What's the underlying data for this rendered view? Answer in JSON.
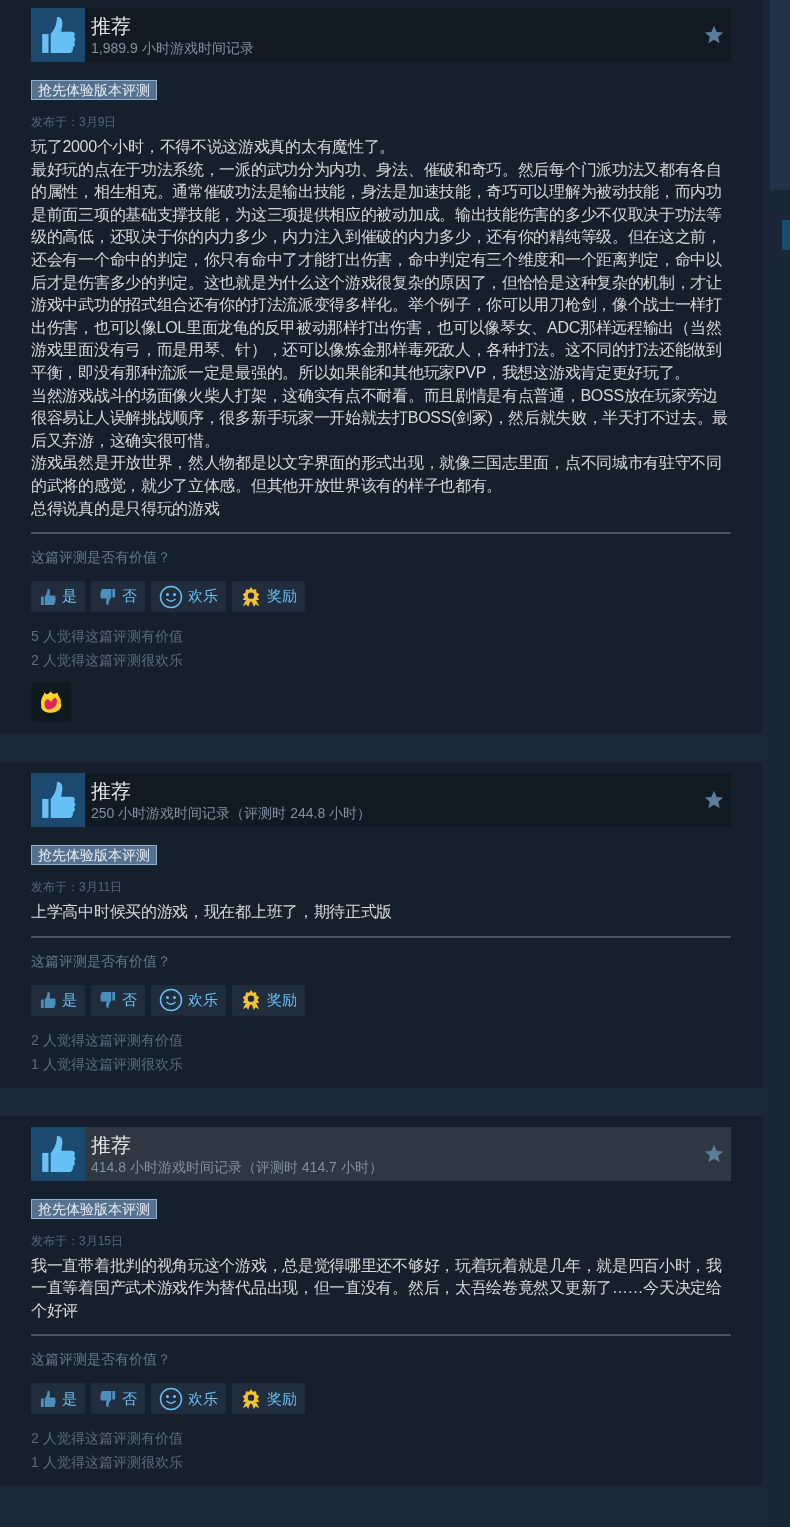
{
  "reviews": [
    {
      "verdict": "推荐",
      "highlighted": false,
      "hours": "1,989.9 小时游戏时间记录",
      "tag": "抢先体验版本评测",
      "posted": "发布于：3月9日",
      "body": [
        "玩了2000个小时，不得不说这游戏真的太有魔性了。",
        "最好玩的点在于功法系统，一派的武功分为内功、身法、催破和奇巧。然后每个门派功法又都有各自的属性，相生相克。通常催破功法是输出技能，身法是加速技能，奇巧可以理解为被动技能，而内功是前面三项的基础支撑技能，为这三项提供相应的被动加成。输出技能伤害的多少不仅取决于功法等级的高低，还取决于你的内力多少，内力注入到催破的内力多少，还有你的精纯等级。但在这之前，还会有一个命中的判定，你只有命中了才能打出伤害，命中判定有三个维度和一个距离判定，命中以后才是伤害多少的判定。这也就是为什么这个游戏很复杂的原因了，但恰恰是这种复杂的机制，才让游戏中武功的招式组合还有你的打法流派变得多样化。举个例子，你可以用刀枪剑，像个战士一样打出伤害，也可以像LOL里面龙龟的反甲被动那样打出伤害，也可以像琴女、ADC那样远程输出（当然游戏里面没有弓，而是用琴、针），还可以像炼金那样毒死敌人，各种打法。这不同的打法还能做到平衡，即没有那种流派一定是最强的。所以如果能和其他玩家PVP，我想这游戏肯定更好玩了。",
        "当然游戏战斗的场面像火柴人打架，这确实有点不耐看。而且剧情是有点普通，BOSS放在玩家旁边很容易让人误解挑战顺序，很多新手玩家一开始就去打BOSS(剑冢)，然后就失败，半天打不过去。最后又弃游，这确实很可惜。",
        "游戏虽然是开放世界，然人物都是以文字界面的形式出现，就像三国志里面，点不同城市有驻守不同的武将的感觉，就少了立体感。但其他开放世界该有的样子也都有。",
        "总得说真的是只得玩的游戏"
      ],
      "question": "这篇评测是否有价值？",
      "buttons": [
        {
          "kind": "thumbs-up",
          "label": "是"
        },
        {
          "kind": "thumbs-down",
          "label": "否"
        },
        {
          "kind": "smile",
          "label": "欢乐"
        },
        {
          "kind": "award",
          "label": "奖励"
        }
      ],
      "stats": [
        "5 人觉得这篇评测有价值",
        "2 人觉得这篇评测很欢乐"
      ],
      "awards": [
        {
          "kind": "flame-heart"
        }
      ]
    },
    {
      "verdict": "推荐",
      "highlighted": false,
      "hours": "250 小时游戏时间记录（评测时 244.8 小时）",
      "tag": "抢先体验版本评测",
      "posted": "发布于：3月11日",
      "body": [
        "上学高中时候买的游戏，现在都上班了，期待正式版"
      ],
      "question": "这篇评测是否有价值？",
      "buttons": [
        {
          "kind": "thumbs-up",
          "label": "是"
        },
        {
          "kind": "thumbs-down",
          "label": "否"
        },
        {
          "kind": "smile",
          "label": "欢乐"
        },
        {
          "kind": "award",
          "label": "奖励"
        }
      ],
      "stats": [
        "2 人觉得这篇评测有价值",
        "1 人觉得这篇评测很欢乐"
      ]
    },
    {
      "verdict": "推荐",
      "highlighted": true,
      "hours": "414.8 小时游戏时间记录（评测时 414.7 小时）",
      "tag": "抢先体验版本评测",
      "posted": "发布于：3月15日",
      "body": [
        "我一直带着批判的视角玩这个游戏，总是觉得哪里还不够好，玩着玩着就是几年，就是四百小时，我一直等着国产武术游戏作为替代品出现，但一直没有。然后，太吾绘卷竟然又更新了……今天决定给个好评"
      ],
      "question": "这篇评测是否有价值？",
      "buttons": [
        {
          "kind": "thumbs-up",
          "label": "是"
        },
        {
          "kind": "thumbs-down",
          "label": "否"
        },
        {
          "kind": "smile",
          "label": "欢乐"
        },
        {
          "kind": "award",
          "label": "奖励"
        }
      ],
      "stats": [
        "2 人觉得这篇评测有价值",
        "1 人觉得这篇评测很欢乐"
      ]
    }
  ]
}
